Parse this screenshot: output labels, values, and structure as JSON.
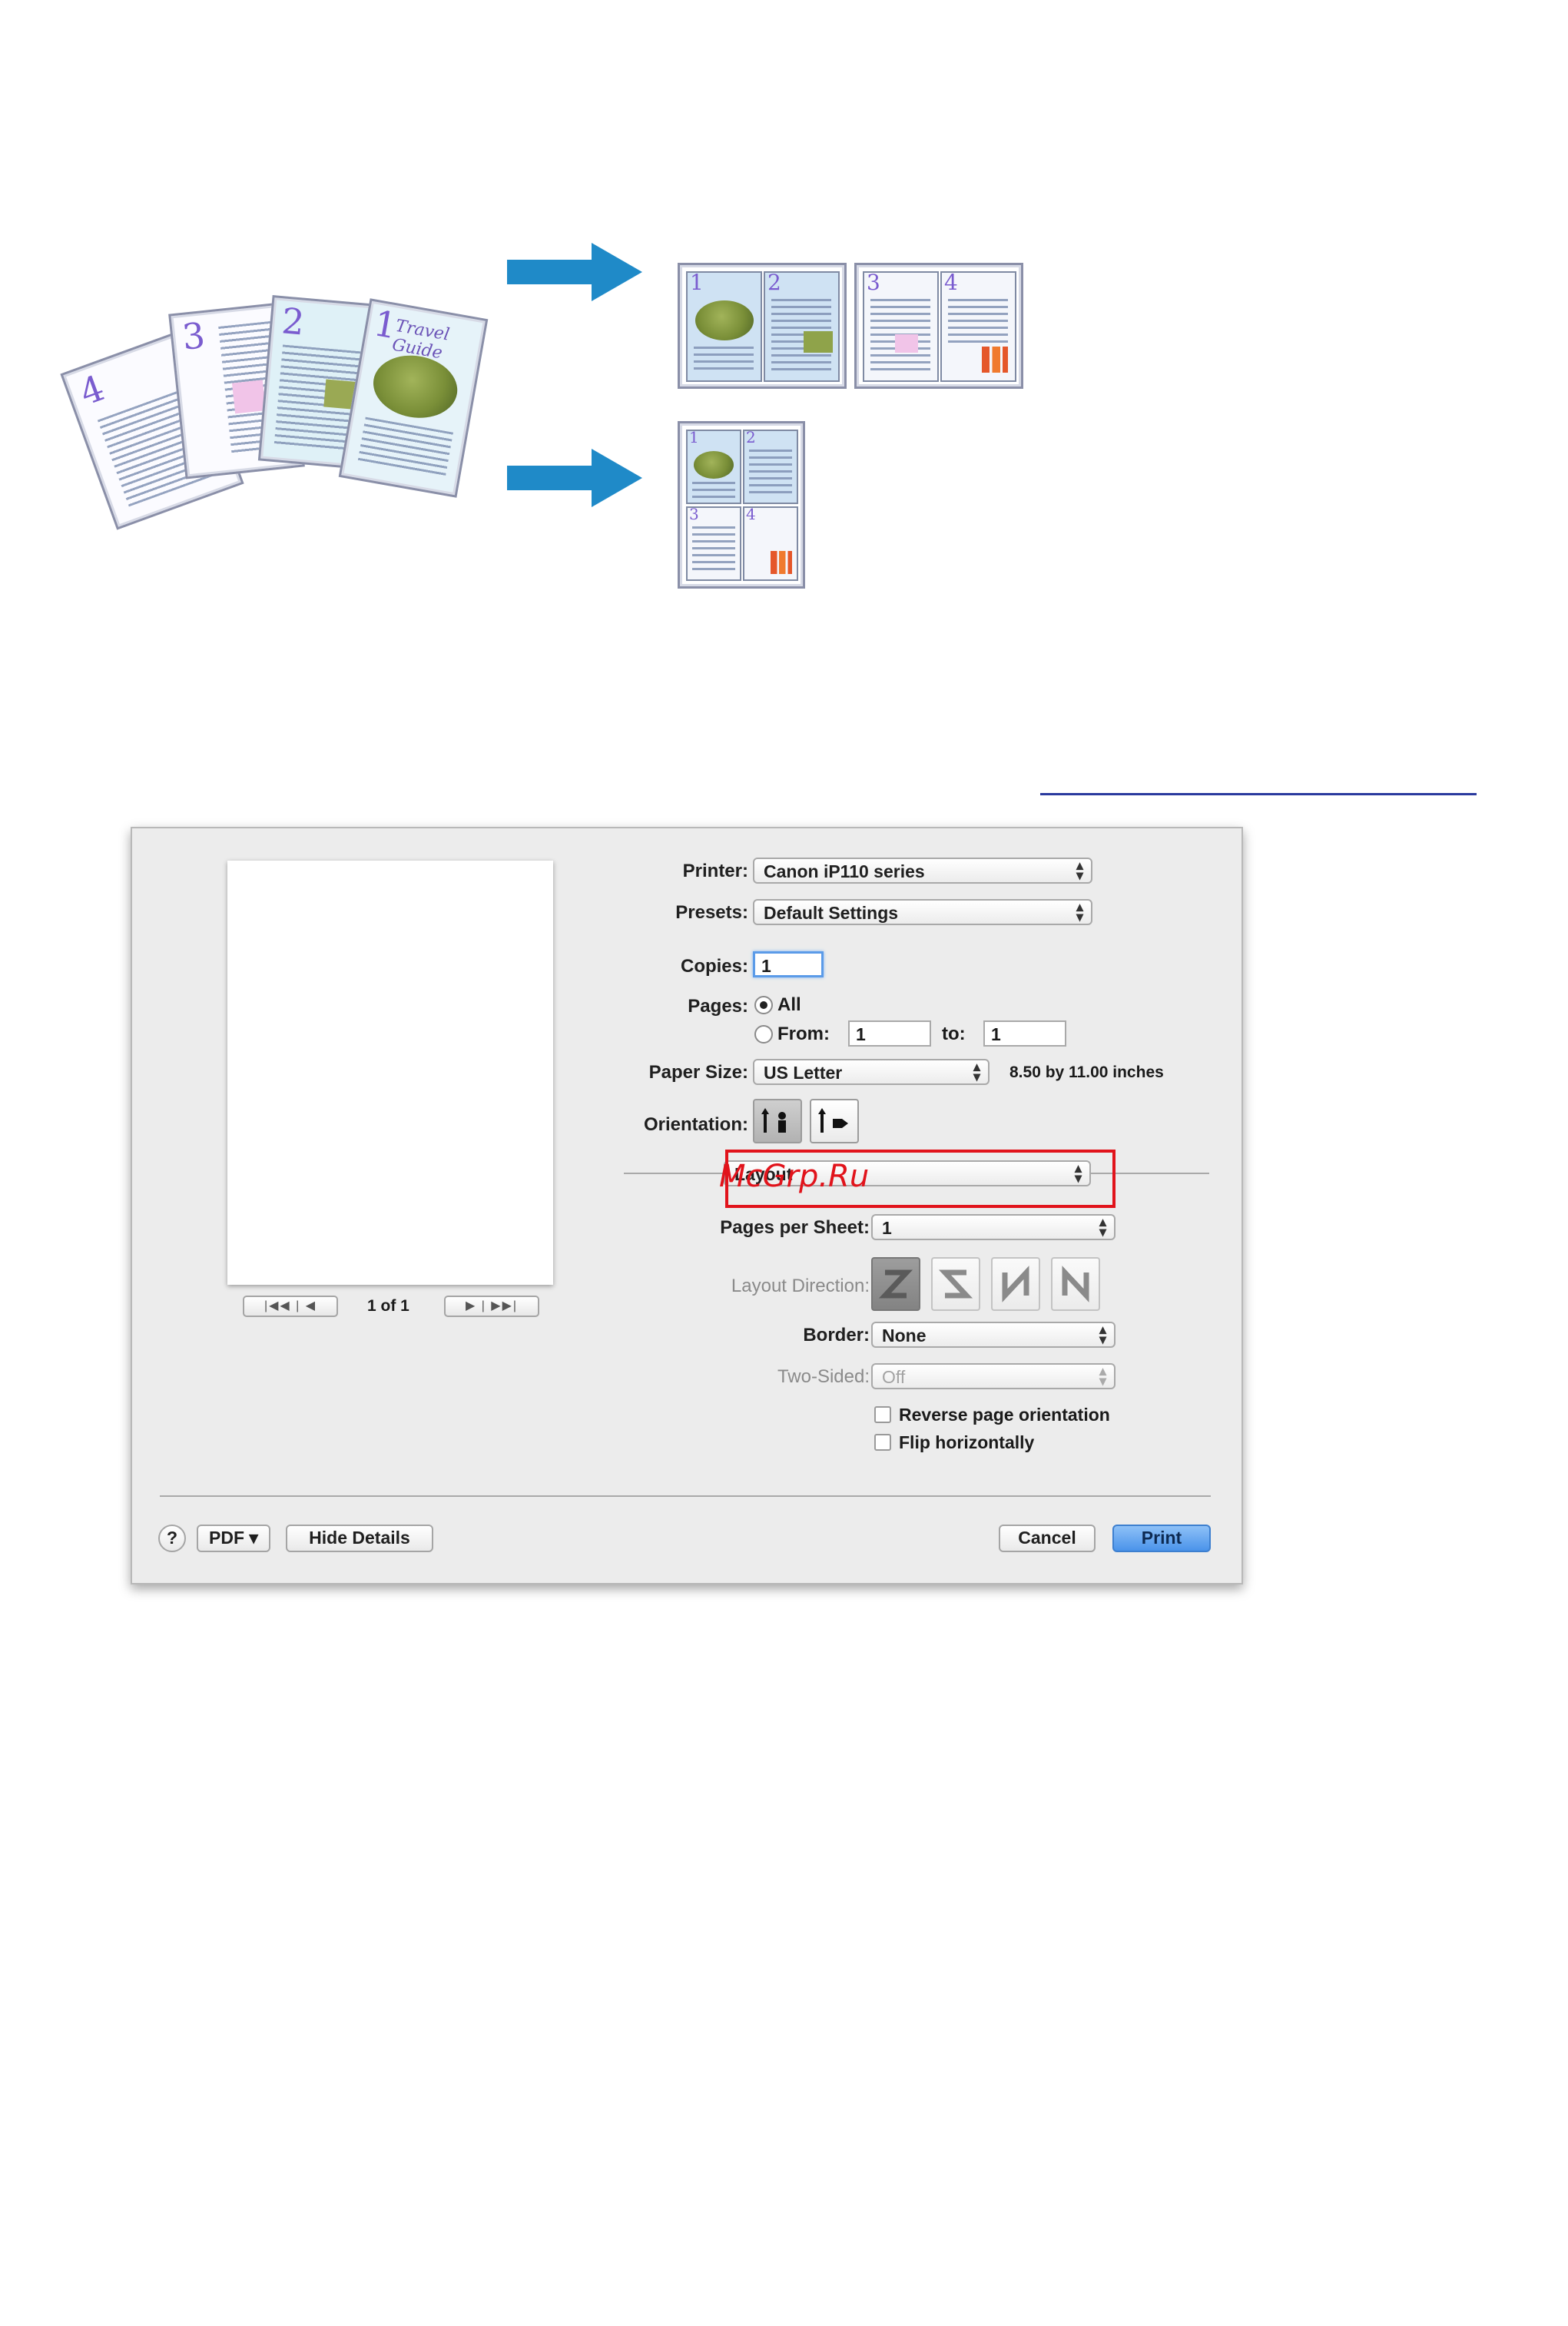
{
  "illustration": {
    "source_pages": [
      "4",
      "3",
      "2",
      "1"
    ],
    "cover_title": "Travel Guide",
    "result_pages": [
      "1",
      "2",
      "3",
      "4"
    ],
    "arrow_color": "#1f8ac8"
  },
  "dialog": {
    "preview": {
      "page_indicator": "1 of 1",
      "first_prev_label": "|◀◀ | ◀",
      "next_last_label": "▶ | ▶▶|"
    },
    "printer": {
      "label": "Printer:",
      "value": "Canon iP110 series"
    },
    "presets": {
      "label": "Presets:",
      "value": "Default Settings"
    },
    "copies": {
      "label": "Copies:",
      "value": "1"
    },
    "pages": {
      "label": "Pages:",
      "all_label": "All",
      "from_label": "From:",
      "from_value": "1",
      "to_label": "to:",
      "to_value": "1",
      "selected": "All"
    },
    "paper_size": {
      "label": "Paper Size:",
      "value": "US Letter",
      "dimensions": "8.50 by 11.00 inches"
    },
    "orientation": {
      "label": "Orientation:",
      "options": [
        "portrait",
        "landscape"
      ],
      "selected": "portrait"
    },
    "section_popup": {
      "value": "Layout"
    },
    "watermark": "McGrp.Ru",
    "pages_per_sheet": {
      "label": "Pages per Sheet:",
      "value": "1"
    },
    "layout_direction": {
      "label": "Layout Direction:",
      "options": [
        "Z",
        "S",
        "N-reverse",
        "N"
      ],
      "selected": "Z"
    },
    "border": {
      "label": "Border:",
      "value": "None"
    },
    "two_sided": {
      "label": "Two-Sided:",
      "value": "Off"
    },
    "reverse_orientation": {
      "label": "Reverse page orientation",
      "checked": false
    },
    "flip_horizontally": {
      "label": "Flip horizontally",
      "checked": false
    },
    "footer": {
      "help_label": "?",
      "pdf_label": "PDF ▾",
      "hide_details_label": "Hide Details",
      "cancel_label": "Cancel",
      "print_label": "Print"
    },
    "highlight_color": "#e1131b",
    "primary_color": "#4a93ea"
  }
}
